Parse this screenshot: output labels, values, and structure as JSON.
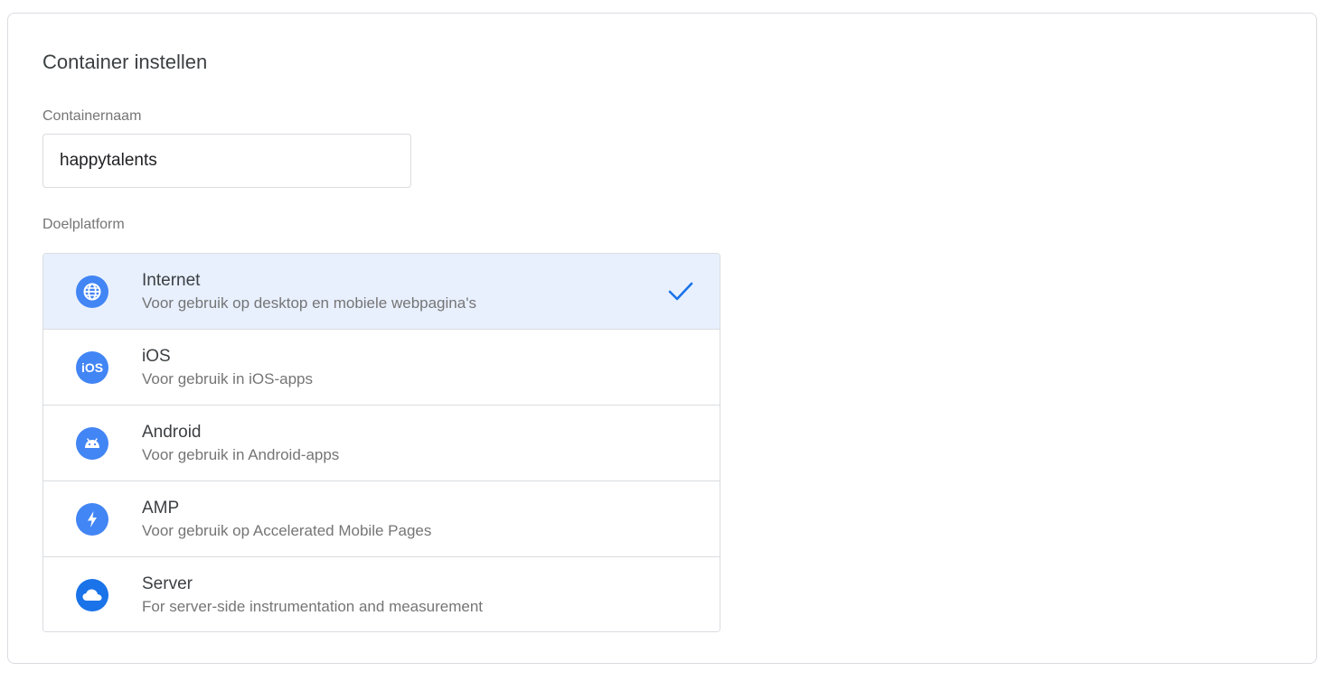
{
  "card": {
    "title": "Container instellen"
  },
  "container_name": {
    "label": "Containernaam",
    "value": "happytalents"
  },
  "platform": {
    "label": "Doelplatform",
    "selected": "Internet",
    "items": [
      {
        "name": "Internet",
        "description": "Voor gebruik op desktop en mobiele webpagina's",
        "icon": "globe-icon"
      },
      {
        "name": "iOS",
        "description": "Voor gebruik in iOS-apps",
        "icon": "ios-icon"
      },
      {
        "name": "Android",
        "description": "Voor gebruik in Android-apps",
        "icon": "android-icon"
      },
      {
        "name": "AMP",
        "description": "Voor gebruik op Accelerated Mobile Pages",
        "icon": "amp-lightning-icon"
      },
      {
        "name": "Server",
        "description": "For server-side instrumentation and measurement",
        "icon": "cloud-icon"
      }
    ]
  },
  "icon_ios_text": "iOS",
  "colors": {
    "accent": "#1a73e8",
    "icon_blue": "#4285f4",
    "selected_bg": "#e8f0fe",
    "border": "#dadce0"
  }
}
